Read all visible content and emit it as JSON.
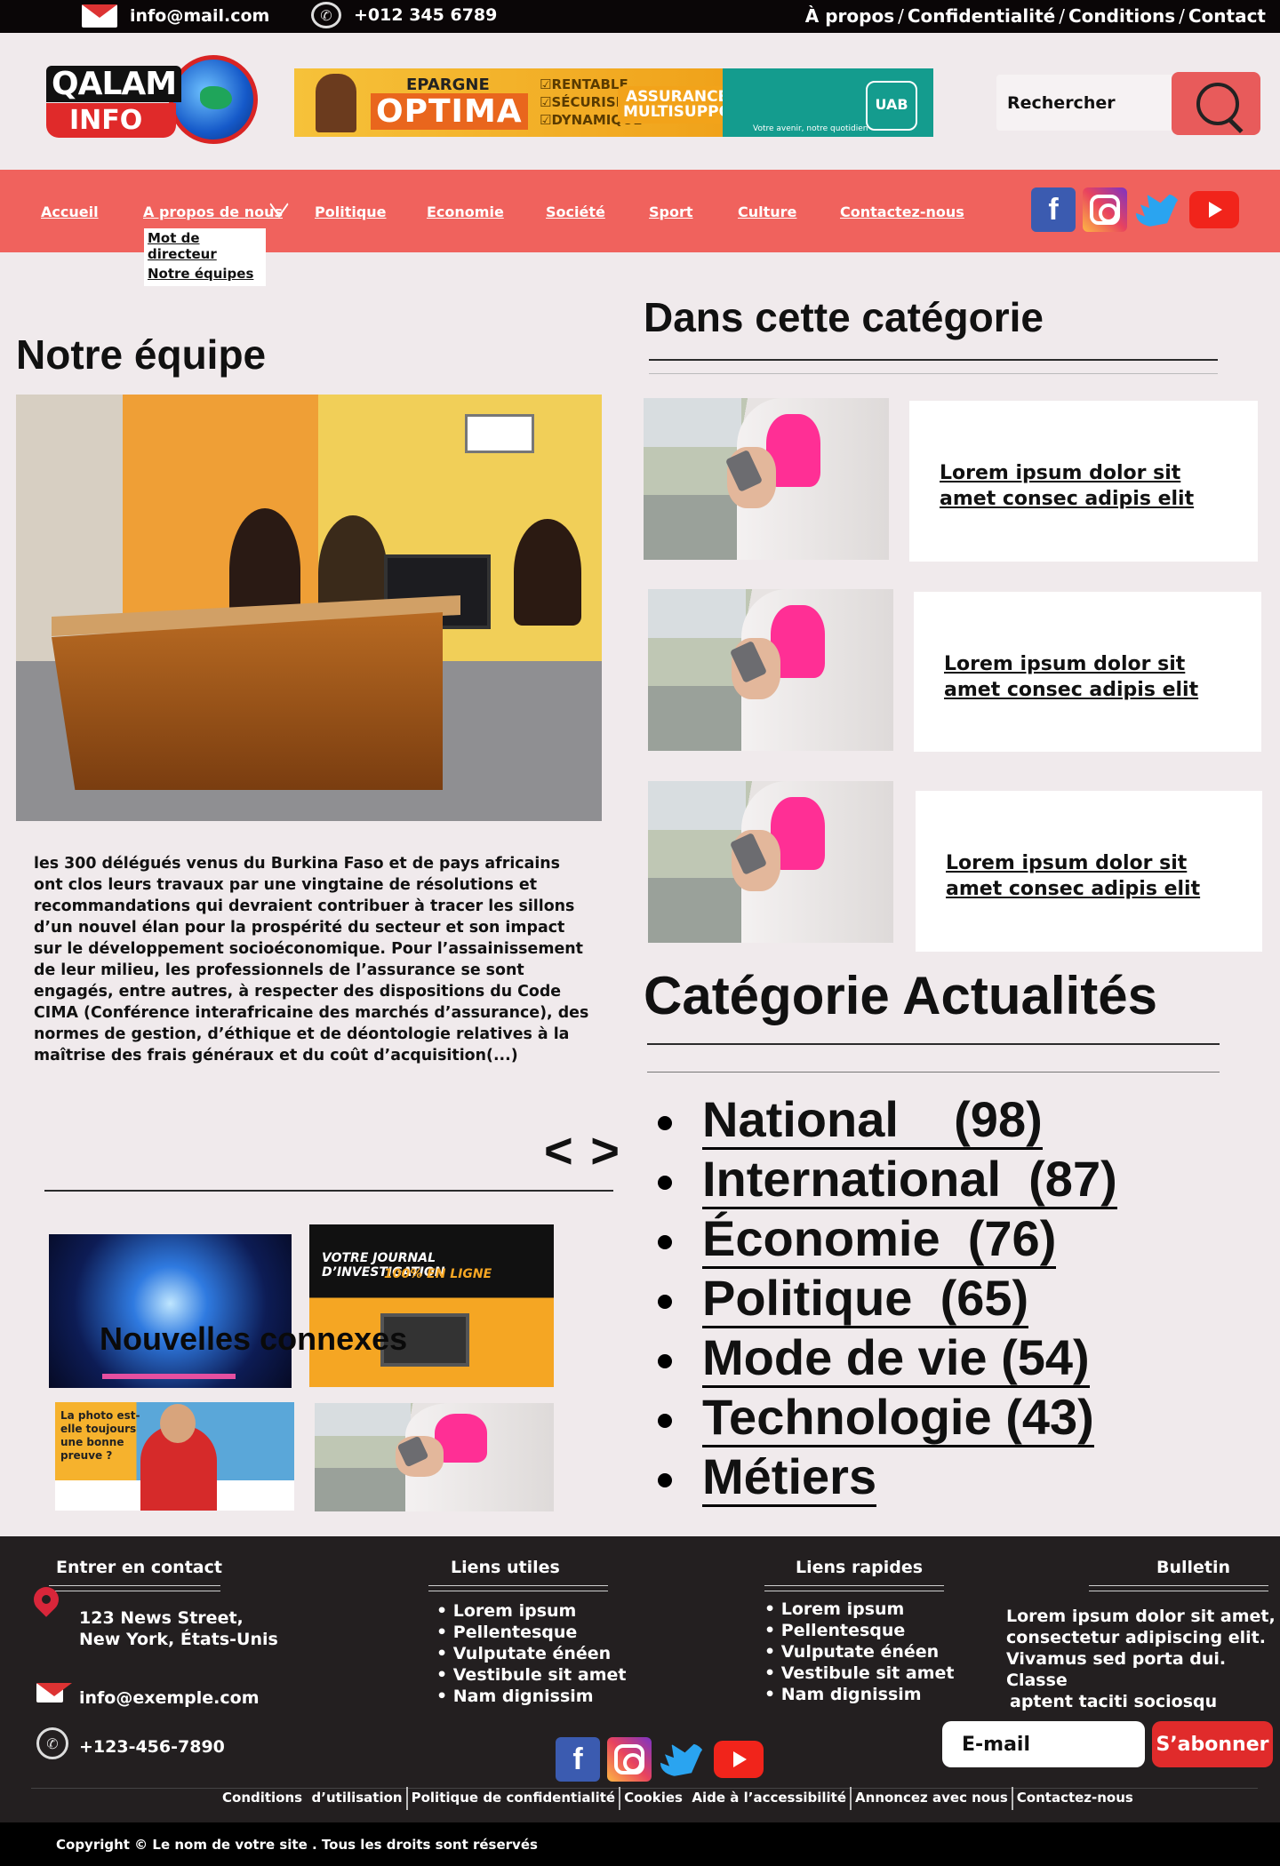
{
  "topbar": {
    "email": "info@mail.com",
    "phone": "+012 345 6789",
    "links": [
      "À propos",
      "Confidentialité",
      "Conditions",
      "Contact"
    ]
  },
  "logo": {
    "line1": "QALAM",
    "line2": "INFO"
  },
  "banner": {
    "epargne": "EPARGNE",
    "optima": "OPTIMA",
    "checks": [
      "☑RENTABLE",
      "☑SÉCURISÉE",
      "☑DYNAMIQUE"
    ],
    "assurance_line1": "ASSURANCE VIE",
    "assurance_line2": "MULTISUPPORTS",
    "brand": "UAB",
    "tagline": "Votre avenir, notre quotidien"
  },
  "search": {
    "placeholder": "Rechercher"
  },
  "nav": {
    "items": [
      "Accueil",
      "A propos de nous",
      "Politique",
      "Economie",
      "Société",
      "Sport",
      "Culture",
      "Contactez-nous"
    ],
    "dropdown": [
      "Mot de directeur",
      "Notre équipes"
    ]
  },
  "social_icons": [
    "facebook-icon",
    "instagram-icon",
    "twitter-icon",
    "youtube-icon"
  ],
  "main": {
    "title": "Notre équipe",
    "article": "les 300 délégués venus du Burkina Faso et de pays africains ont clos leurs travaux par une vingtaine de résolutions et recommandations qui devraient contribuer à tracer les sillons d’un nouvel élan pour la prospérité du secteur et son impact sur le développement socioéconomique. Pour l’assainissement de leur milieu, les professionnels de l’assurance se sont engagés, entre autres, à respecter des dispositions du Code CIMA (Conférence interafricaine des marchés d’assurance), des normes de gestion, d’éthique et de déontologie relatives à la maîtrise des frais généraux et du coût d’acquisition(...)",
    "pager": "< >",
    "related_title": "Nouvelles connexes",
    "related": {
      "investigation_headline": "VOTRE JOURNAL D’INVESTIGATION",
      "investigation_sub": "100% EN LIGNE",
      "photo_text": "La photo est-elle toujours une bonne preuve ?"
    }
  },
  "sidebar": {
    "category_title": "Dans cette catégorie",
    "cards": [
      {
        "title": "Lorem ipsum dolor sit amet consec adipis elit"
      },
      {
        "title": "Lorem ipsum dolor sit amet consec adipis elit"
      },
      {
        "title": "Lorem ipsum dolor sit amet consec adipis elit"
      }
    ],
    "news_title": "Catégorie Actualités",
    "categories": [
      {
        "name": "National",
        "count": "(98)"
      },
      {
        "name": "International",
        "count": "(87)"
      },
      {
        "name": "Économie",
        "count": "(76)"
      },
      {
        "name": "Politique",
        "count": "(65)"
      },
      {
        "name": "Mode de vie",
        "count": "(54)"
      },
      {
        "name": "Technologie",
        "count": "(43)"
      },
      {
        "name": "Métiers",
        "count": ""
      }
    ]
  },
  "footer": {
    "contact_title": "Entrer en contact",
    "address_line1": "123 News Street,",
    "address_line2": "New York, États-Unis",
    "email": "info@exemple.com",
    "phone": "+123-456-7890",
    "useful_title": "Liens utiles",
    "useful": [
      "Lorem ipsum",
      "Pellentesque",
      "Vulputate énéen",
      "Vestibule sit amet",
      "Nam dignissim"
    ],
    "quick_title": "Liens rapides",
    "quick": [
      "Lorem ipsum",
      "Pellentesque",
      "Vulputate énéen",
      "Vestibule sit amet",
      "Nam dignissim"
    ],
    "newsletter_title": "Bulletin",
    "newsletter_text_1": "Lorem ipsum dolor sit amet,",
    "newsletter_text_2": "consectetur adipiscing elit.",
    "newsletter_text_3": "Vivamus sed porta dui. Classe",
    "newsletter_text_4": "aptent taciti sociosqu",
    "email_placeholder": "E-mail",
    "subscribe": "S’abonner",
    "bottom_links": [
      "Conditions  d’utilisation",
      "Politique de confidentialité",
      "Cookies  Aide à l’accessibilité",
      "Annoncez avec nous",
      "Contactez-nous"
    ],
    "copyright": "Copyright © Le nom de votre site . Tous les droits sont réservés"
  },
  "colors": {
    "accent": "#f0625d",
    "dark": "#231f20",
    "page_bg": "#f0eaec",
    "subscribe": "#e02b2b"
  }
}
